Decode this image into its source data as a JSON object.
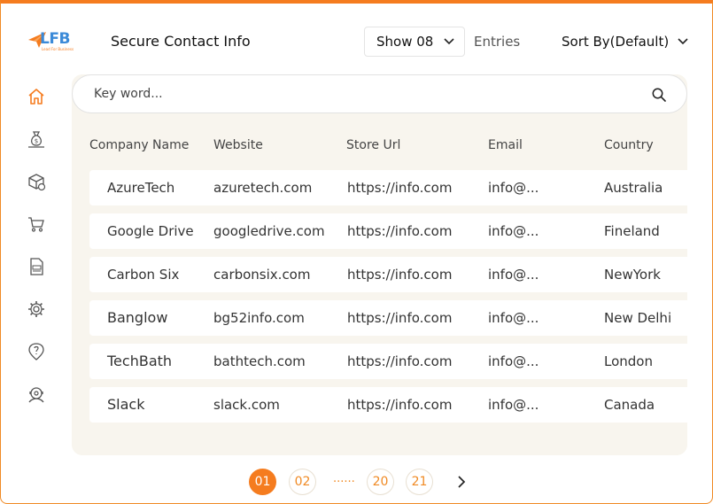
{
  "logo": {
    "text": "LFB",
    "tagline": "Lead For Business"
  },
  "header": {
    "title": "Secure Contact Info",
    "show_select": "Show 08",
    "entries_label": "Entries",
    "sort_select": "Sort By(Default)"
  },
  "sidebar": {
    "items": [
      {
        "icon": "home-icon",
        "active": true
      },
      {
        "icon": "money-bag-icon"
      },
      {
        "icon": "package-icon"
      },
      {
        "icon": "cart-icon"
      },
      {
        "icon": "invoice-icon"
      },
      {
        "icon": "settings-icon"
      },
      {
        "icon": "idea-icon"
      },
      {
        "icon": "support-icon"
      }
    ]
  },
  "search": {
    "placeholder": "Key word..."
  },
  "table": {
    "columns": [
      "Company Name",
      "Website",
      "Store Url",
      "Email",
      "Country"
    ],
    "rows": [
      {
        "company": "AzureTech",
        "website": "azuretech.com",
        "store_url": "https://info.com",
        "email": "info@...",
        "country": "Australia"
      },
      {
        "company": "Google Drive",
        "website": "googledrive.com",
        "store_url": "https://info.com",
        "email": "info@...",
        "country": "Fineland"
      },
      {
        "company": "Carbon Six",
        "website": "carbonsix.com",
        "store_url": "https://info.com",
        "email": "info@...",
        "country": "NewYork"
      },
      {
        "company": "Banglow",
        "website": "bg52info.com",
        "store_url": "https://info.com",
        "email": "info@...",
        "country": "New Delhi"
      },
      {
        "company": "TechBath",
        "website": "bathtech.com",
        "store_url": "https://info.com",
        "email": "info@...",
        "country": "London"
      },
      {
        "company": "Slack",
        "website": "slack.com",
        "store_url": "https://info.com",
        "email": "info@...",
        "country": "Canada"
      }
    ]
  },
  "pagination": {
    "pages": [
      "01",
      "02",
      "20",
      "21"
    ],
    "active": "01",
    "ellipsis": "......"
  },
  "colors": {
    "accent": "#f57c1f",
    "panel": "#f8f5ee",
    "logo_blue": "#3b8ad8"
  }
}
